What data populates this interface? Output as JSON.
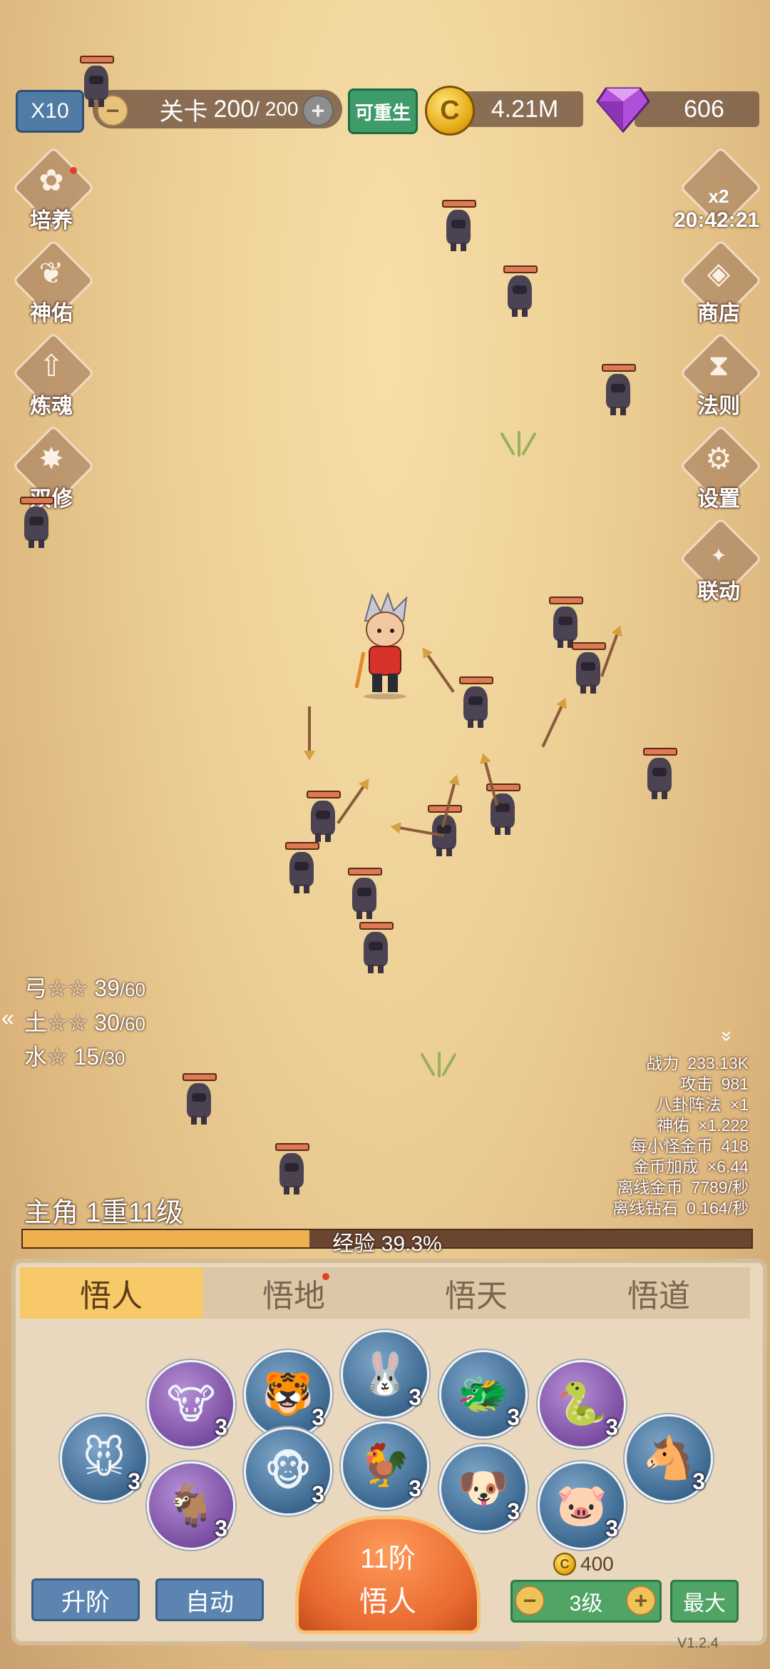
{
  "topbar": {
    "speed": "X10",
    "stage_label": "关卡",
    "stage_current": "200",
    "stage_max": "/ 200",
    "rebirth": "可重生",
    "coins": "4.21M",
    "gems": "606"
  },
  "left_menu": [
    "培养",
    "神佑",
    "炼魂",
    "双修"
  ],
  "right_menu": {
    "boost": "x2",
    "timer": "20:42:21",
    "items": [
      "商店",
      "法则",
      "设置",
      "联动"
    ]
  },
  "element_stats": [
    {
      "label": "弓☆☆",
      "cur": "39",
      "max": "/60"
    },
    {
      "label": "土☆☆",
      "cur": "30",
      "max": "/60"
    },
    {
      "label": "水☆",
      "cur": "15",
      "max": "/30"
    }
  ],
  "stats": [
    {
      "k": "战力",
      "v": "233.13K"
    },
    {
      "k": "攻击",
      "v": "981"
    },
    {
      "k": "八卦阵法",
      "v": "×1"
    },
    {
      "k": "神佑",
      "v": "×1.222"
    },
    {
      "k": "每小怪金币",
      "v": "418"
    },
    {
      "k": "金币加成",
      "v": "×6.44"
    },
    {
      "k": "离线金币",
      "v": "7789/秒"
    },
    {
      "k": "离线钻石",
      "v": "0.164/秒"
    }
  ],
  "hero": {
    "level": "主角 1重11级",
    "exp_text": "经验 39.3%",
    "exp_fraction": 0.393
  },
  "tabs": [
    "悟人",
    "悟地",
    "悟天",
    "悟道"
  ],
  "zodiac": [
    {
      "icon": "rat-icon",
      "glyph": "🐭",
      "level": "3",
      "tone": "blue"
    },
    {
      "icon": "ox-icon",
      "glyph": "🐮",
      "level": "3",
      "tone": "purple"
    },
    {
      "icon": "tiger-icon",
      "glyph": "🐯",
      "level": "3",
      "tone": "blue"
    },
    {
      "icon": "rabbit-icon",
      "glyph": "🐰",
      "level": "3",
      "tone": "blue"
    },
    {
      "icon": "dragon-icon",
      "glyph": "🐲",
      "level": "3",
      "tone": "blue"
    },
    {
      "icon": "snake-icon",
      "glyph": "🐍",
      "level": "3",
      "tone": "purple"
    },
    {
      "icon": "horse-icon",
      "glyph": "🐴",
      "level": "3",
      "tone": "blue"
    },
    {
      "icon": "goat-icon",
      "glyph": "🐐",
      "level": "3",
      "tone": "purple"
    },
    {
      "icon": "monkey-icon",
      "glyph": "🐵",
      "level": "3",
      "tone": "blue"
    },
    {
      "icon": "rooster-icon",
      "glyph": "🐓",
      "level": "3",
      "tone": "blue"
    },
    {
      "icon": "dog-icon",
      "glyph": "🐶",
      "level": "3",
      "tone": "blue"
    },
    {
      "icon": "pig-icon",
      "glyph": "🐷",
      "level": "3",
      "tone": "blue"
    }
  ],
  "bottom": {
    "upgrade": "升阶",
    "auto": "自动",
    "center_line1": "11阶",
    "center_line2": "悟人",
    "cost": "400",
    "level": "3级",
    "max": "最大",
    "version": "V1.2.4"
  }
}
